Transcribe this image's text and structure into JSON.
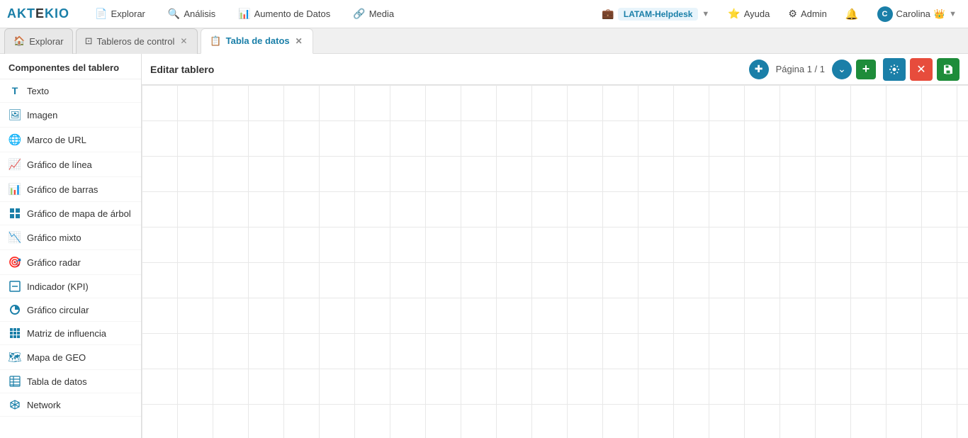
{
  "logo": "AKTEKIO",
  "navbar": {
    "items": [
      {
        "label": "Explorar",
        "icon": "📄"
      },
      {
        "label": "Análisis",
        "icon": "🔍"
      },
      {
        "label": "Aumento de Datos",
        "icon": "📊"
      },
      {
        "label": "Media",
        "icon": "🔗"
      }
    ],
    "right": {
      "helpdesk": "LATAM-Helpdesk",
      "help": "Ayuda",
      "admin": "Admin",
      "user": "Carolina"
    }
  },
  "tabs": [
    {
      "label": "Explorar",
      "active": false,
      "closable": false,
      "icon": ""
    },
    {
      "label": "Tableros de control",
      "active": false,
      "closable": true,
      "icon": ""
    },
    {
      "label": "Tabla de datos",
      "active": true,
      "closable": true,
      "icon": "📋"
    }
  ],
  "sidebar": {
    "header": "Componentes del tablero",
    "items": [
      {
        "label": "Texto",
        "icon": "T"
      },
      {
        "label": "Imagen",
        "icon": "🖼"
      },
      {
        "label": "Marco de URL",
        "icon": "🌐"
      },
      {
        "label": "Gráfico de línea",
        "icon": "📈"
      },
      {
        "label": "Gráfico de barras",
        "icon": "📊"
      },
      {
        "label": "Gráfico de mapa de árbol",
        "icon": "⊞"
      },
      {
        "label": "Gráfico mixto",
        "icon": "📉"
      },
      {
        "label": "Gráfico radar",
        "icon": "🎯"
      },
      {
        "label": "Indicador (KPI)",
        "icon": "⊡"
      },
      {
        "label": "Gráfico circular",
        "icon": "◔"
      },
      {
        "label": "Matriz de influencia",
        "icon": "⊞"
      },
      {
        "label": "Mapa de GEO",
        "icon": "🗺"
      },
      {
        "label": "Tabla de datos",
        "icon": "⊞"
      },
      {
        "label": "Network",
        "icon": "⬡"
      }
    ]
  },
  "content": {
    "title": "Editar tablero",
    "page_label": "Página 1 / 1",
    "toolbar": {
      "settings_tooltip": "Ajustes",
      "close_tooltip": "Cerrar",
      "save_tooltip": "Guardar"
    }
  }
}
